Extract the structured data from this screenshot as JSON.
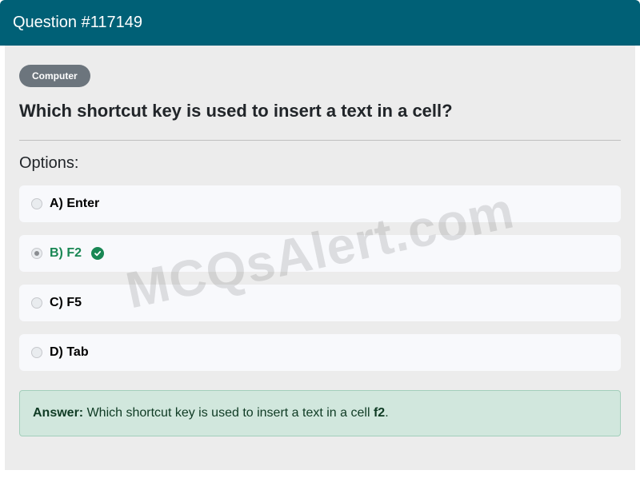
{
  "header": {
    "title": "Question #117149"
  },
  "category": "Computer",
  "question": "Which shortcut key is used to insert a text in a cell?",
  "options_label": "Options:",
  "options": [
    {
      "label": "A) Enter",
      "selected": false,
      "correct": false
    },
    {
      "label": "B) F2",
      "selected": true,
      "correct": true
    },
    {
      "label": "C) F5",
      "selected": false,
      "correct": false
    },
    {
      "label": "D) Tab",
      "selected": false,
      "correct": false
    }
  ],
  "answer": {
    "prefix": "Answer:",
    "text": " Which shortcut key is used to insert a text in a cell ",
    "value": "f2",
    "suffix": "."
  },
  "watermark": "MCQsAlert.com",
  "colors": {
    "header_bg": "#006076",
    "correct": "#198754",
    "answer_bg": "#d1e7dd"
  }
}
